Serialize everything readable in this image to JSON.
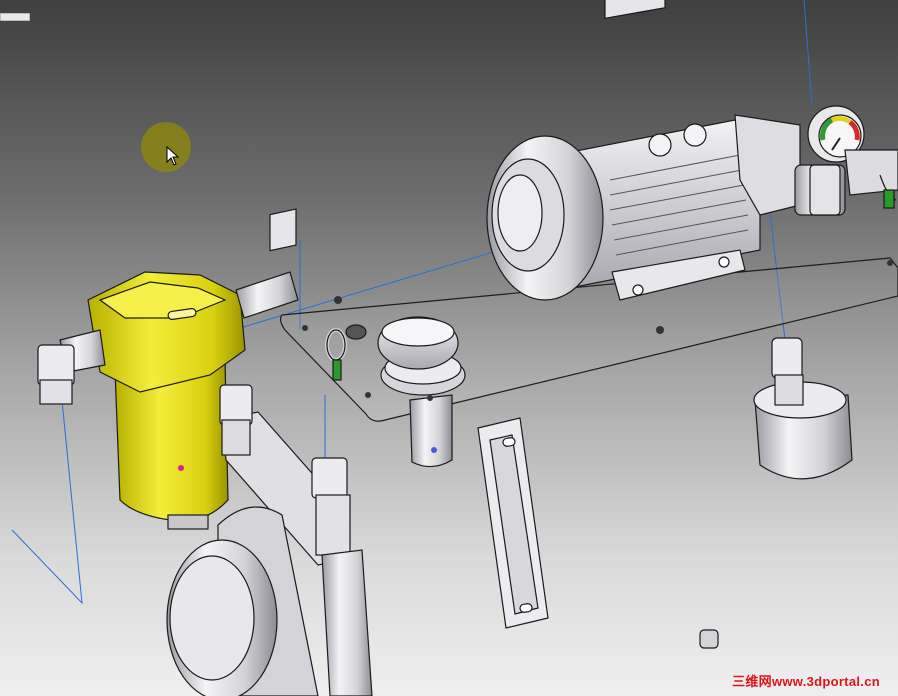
{
  "viewport": {
    "background_top": "#3f3f3f",
    "background_bottom": "#efefef",
    "highlight_color": "#e9e22b",
    "construction_line_color": "#2a6fd6"
  },
  "toolbar": {
    "marker_icon": "toolbar-stub-icon"
  },
  "cursor": {
    "icon": "arrow-cursor-icon",
    "highlight_color": "#968c00"
  },
  "model": {
    "parts": [
      "electric-motor",
      "pressure-gauge",
      "filter-assembly",
      "tank-cover-plate",
      "filler-breather-cap",
      "level-gauge",
      "suction-strainer",
      "elbow-fitting",
      "eye-bolt",
      "drain-plug"
    ]
  },
  "watermark": {
    "text": "三维网www.3dportal.cn"
  }
}
